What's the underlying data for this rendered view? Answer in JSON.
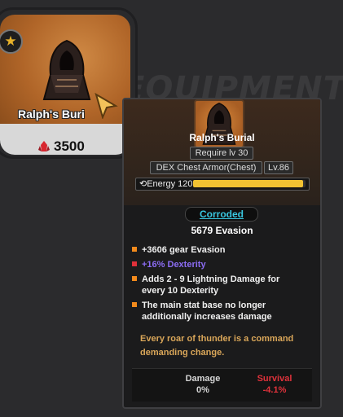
{
  "background": {
    "watermark": "EQUIPMENT"
  },
  "shop_card": {
    "name": "Ralph's Buri",
    "price": "3500",
    "star_icon": "star-icon",
    "currency_icon": "red-crystal-icon",
    "accent": "#b8692a"
  },
  "tooltip": {
    "name": "Ralph's Burial",
    "requirement": "Require lv 30",
    "type": "DEX Chest Armor(Chest)",
    "level": "Lv.86",
    "energy_label": "Energy 120",
    "energy_fraction": 0.98,
    "status": "Corroded",
    "base_stat": "5679 Evasion",
    "affixes": [
      {
        "text": "+3606 gear Evasion",
        "color": "#f0f0f0"
      },
      {
        "text": "+16% Dexterity",
        "color": "#8b6cf2"
      },
      {
        "text": "Adds 2 - 9 Lightning Damage for every 10 Dexterity",
        "color": "#f0f0f0"
      },
      {
        "text": "The main stat base no longer additionally increases damage",
        "color": "#f0f0f0"
      }
    ],
    "flavor": "Every roar of thunder is a command demanding change.",
    "stats": {
      "damage_label": "Damage",
      "damage_value": "0%",
      "survival_label": "Survival",
      "survival_value": "-4.1%"
    }
  }
}
